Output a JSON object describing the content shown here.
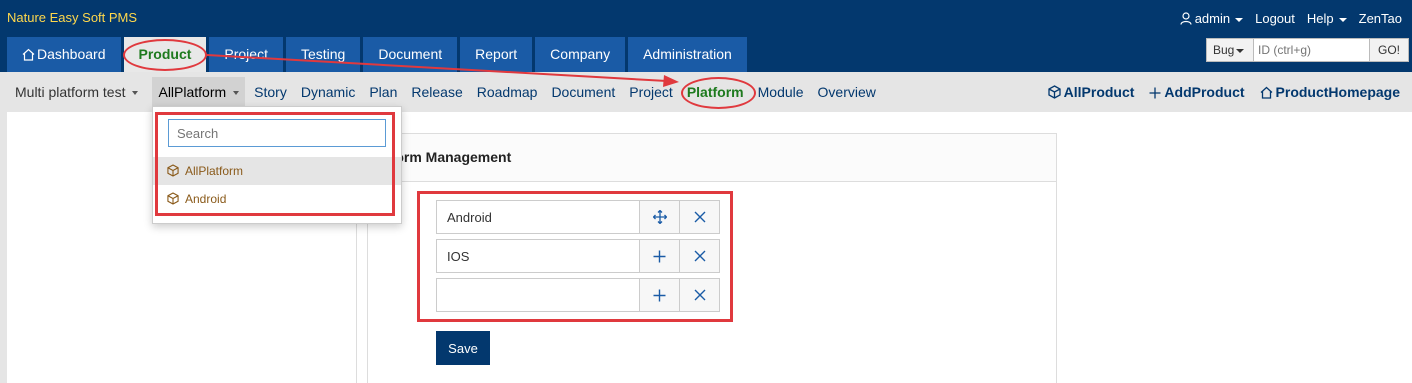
{
  "brand": "Nature Easy Soft PMS",
  "user_menu": {
    "user": "admin",
    "logout": "Logout",
    "help": "Help",
    "zentao": "ZenTao"
  },
  "main_nav": {
    "dashboard": "Dashboard",
    "product": "Product",
    "project": "Project",
    "testing": "Testing",
    "document": "Document",
    "report": "Report",
    "company": "Company",
    "administration": "Administration"
  },
  "search": {
    "type": "Bug",
    "placeholder": "ID (ctrl+g)",
    "go": "GO!"
  },
  "sub_nav": {
    "product_switcher": "Multi platform test",
    "platform_switcher": "AllPlatform",
    "items": {
      "story": "Story",
      "dynamic": "Dynamic",
      "plan": "Plan",
      "release": "Release",
      "roadmap": "Roadmap",
      "document": "Document",
      "project": "Project",
      "platform": "Platform",
      "module": "Module",
      "overview": "Overview"
    },
    "actions": {
      "all_product": "AllProduct",
      "add_product": "AddProduct",
      "product_homepage": "ProductHomepage"
    }
  },
  "platform_dropdown": {
    "search_placeholder": "Search",
    "options": [
      "AllPlatform",
      "Android"
    ]
  },
  "panel": {
    "title": "tform Management",
    "rows": [
      "Android",
      "IOS",
      ""
    ],
    "save": "Save"
  },
  "colors": {
    "header_bg": "#03386e",
    "tab_bg": "#1a5ba6",
    "active_green": "#1e7a1e",
    "annotation_red": "#e0393e",
    "brand_yellow": "#ffd84c"
  }
}
